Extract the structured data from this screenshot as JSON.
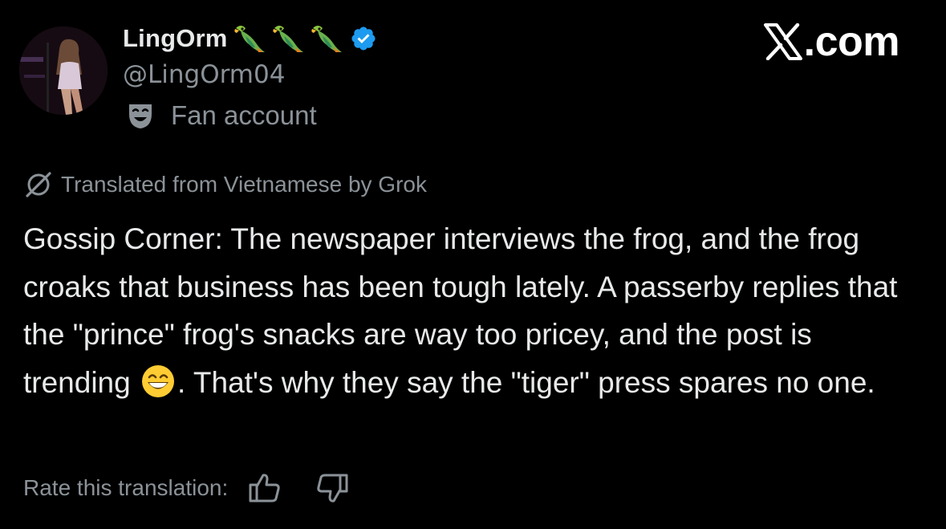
{
  "profile": {
    "display_name": "LingOrm",
    "name_emojis": [
      "parrot-icon",
      "parrot-icon",
      "parrot-icon"
    ],
    "verified": true,
    "handle": "@LingOrm04",
    "fan_label": "Fan account"
  },
  "brand": {
    "text": ".com"
  },
  "translation": {
    "note": "Translated from Vietnamese by Grok",
    "body_part1": "Gossip Corner: The newspaper interviews the frog, and the frog croaks that business has been tough lately. A passerby replies that the \"prince\" frog's snacks are way too pricey, and the post is trending ",
    "body_part2": ". That's why they say the \"tiger\" press spares no one.",
    "rate_label": "Rate this translation:"
  },
  "colors": {
    "background": "#000000",
    "primary_text": "#e7e9ea",
    "secondary_text": "#8b9298",
    "verified_blue": "#1d9bf0"
  }
}
